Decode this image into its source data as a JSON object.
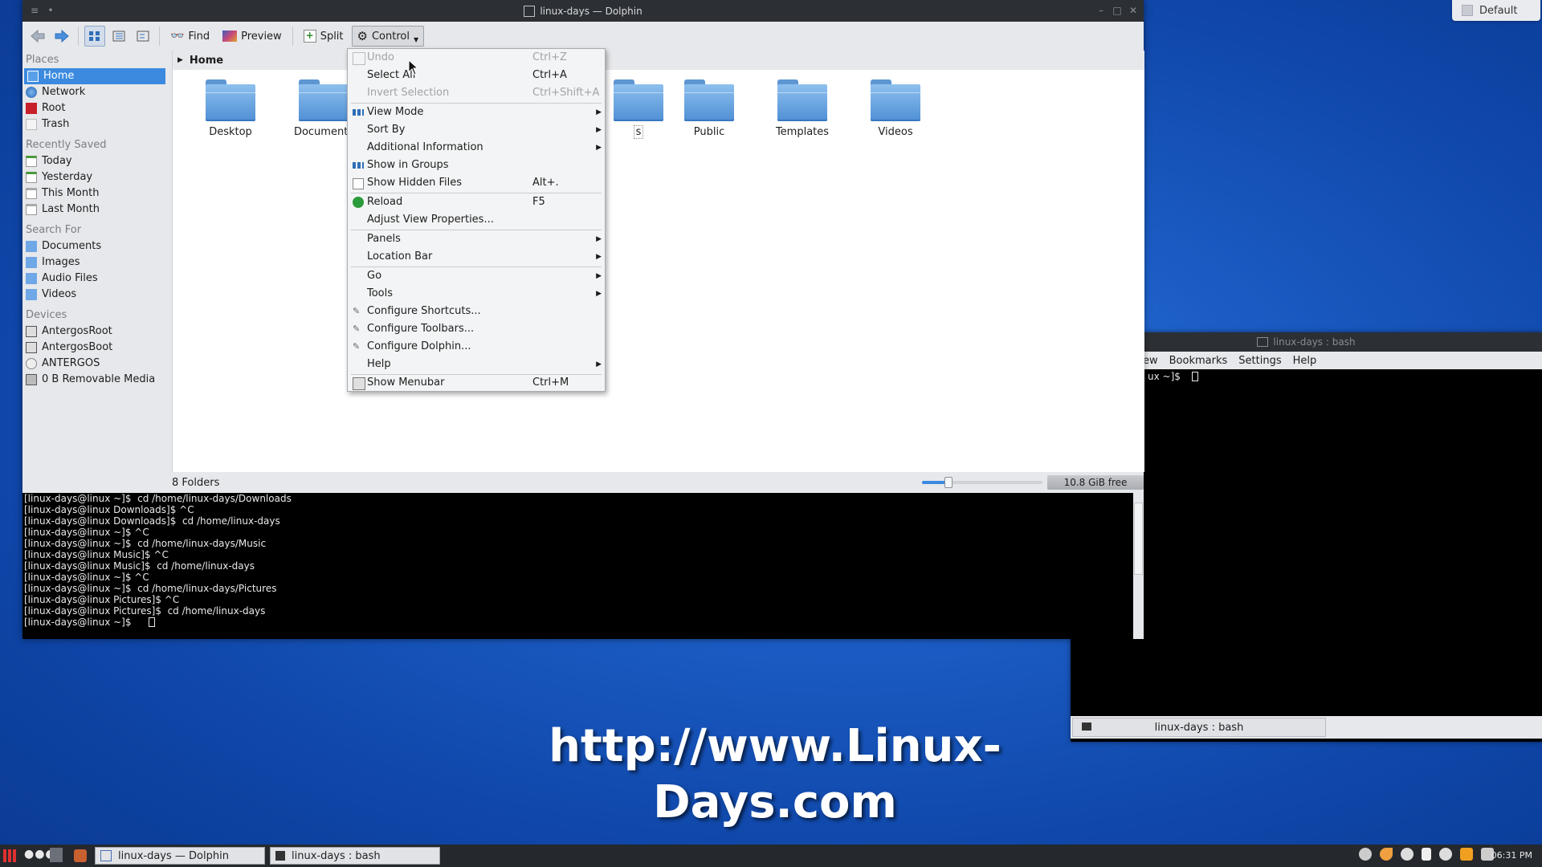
{
  "desktop": {
    "default_widget_label": "Default",
    "watermark": "http://www.Linux-Days.com"
  },
  "dolphin": {
    "title": "linux-days — Dolphin",
    "toolbar": {
      "find": "Find",
      "preview": "Preview",
      "split": "Split",
      "control": "Control"
    },
    "sidebar": {
      "places_head": "Places",
      "places": [
        "Home",
        "Network",
        "Root",
        "Trash"
      ],
      "recent_head": "Recently Saved",
      "recent": [
        "Today",
        "Yesterday",
        "This Month",
        "Last Month"
      ],
      "search_head": "Search For",
      "search": [
        "Documents",
        "Images",
        "Audio Files",
        "Videos"
      ],
      "devices_head": "Devices",
      "devices": [
        "AntergosRoot",
        "AntergosBoot",
        "ANTERGOS",
        "0 B Removable Media"
      ]
    },
    "breadcrumb": "Home",
    "folders": [
      "Desktop",
      "Documents",
      "Public",
      "Templates",
      "Videos"
    ],
    "partial_folder_label": "s",
    "status": {
      "count": "8 Folders",
      "free": "10.8 GiB free",
      "zoom_fraction": 0.22
    },
    "terminal_lines": [
      "[linux-days@linux ~]$  cd /home/linux-days/Downloads",
      "[linux-days@linux Downloads]$ ^C",
      "[linux-days@linux Downloads]$  cd /home/linux-days",
      "[linux-days@linux ~]$ ^C",
      "[linux-days@linux ~]$  cd /home/linux-days/Music",
      "[linux-days@linux Music]$ ^C",
      "[linux-days@linux Music]$  cd /home/linux-days",
      "[linux-days@linux ~]$ ^C",
      "[linux-days@linux ~]$  cd /home/linux-days/Pictures",
      "[linux-days@linux Pictures]$ ^C",
      "[linux-days@linux Pictures]$  cd /home/linux-days",
      "[linux-days@linux ~]$  "
    ]
  },
  "menu": {
    "undo": {
      "label": "Undo",
      "shortcut": "Ctrl+Z"
    },
    "select_all": {
      "label": "Select All",
      "shortcut": "Ctrl+A"
    },
    "invert": {
      "label": "Invert Selection",
      "shortcut": "Ctrl+Shift+A"
    },
    "view_mode": "View Mode",
    "sort_by": "Sort By",
    "additional_info": "Additional Information",
    "show_groups": "Show in Groups",
    "show_hidden": {
      "label": "Show Hidden Files",
      "shortcut": "Alt+."
    },
    "reload": {
      "label": "Reload",
      "shortcut": "F5"
    },
    "adjust_view": "Adjust View Properties...",
    "panels": "Panels",
    "location_bar": "Location Bar",
    "go": "Go",
    "tools": "Tools",
    "conf_shortcuts": "Configure Shortcuts...",
    "conf_toolbars": "Configure Toolbars...",
    "conf_dolphin": "Configure Dolphin...",
    "help": "Help",
    "show_menubar": {
      "label": "Show Menubar",
      "shortcut": "Ctrl+M"
    }
  },
  "terminal2": {
    "title": "linux-days : bash",
    "menubar": [
      "ew",
      "Bookmarks",
      "Settings",
      "Help"
    ],
    "prompt": "ux ~]$",
    "tab_label": "linux-days : bash"
  },
  "taskbar": {
    "task1": "linux-days — Dolphin",
    "task2": "linux-days : bash",
    "clock": "06:31 PM"
  },
  "colors": {
    "selection": "#3b8ae0",
    "desktop_blue": "#1b5cc4"
  }
}
